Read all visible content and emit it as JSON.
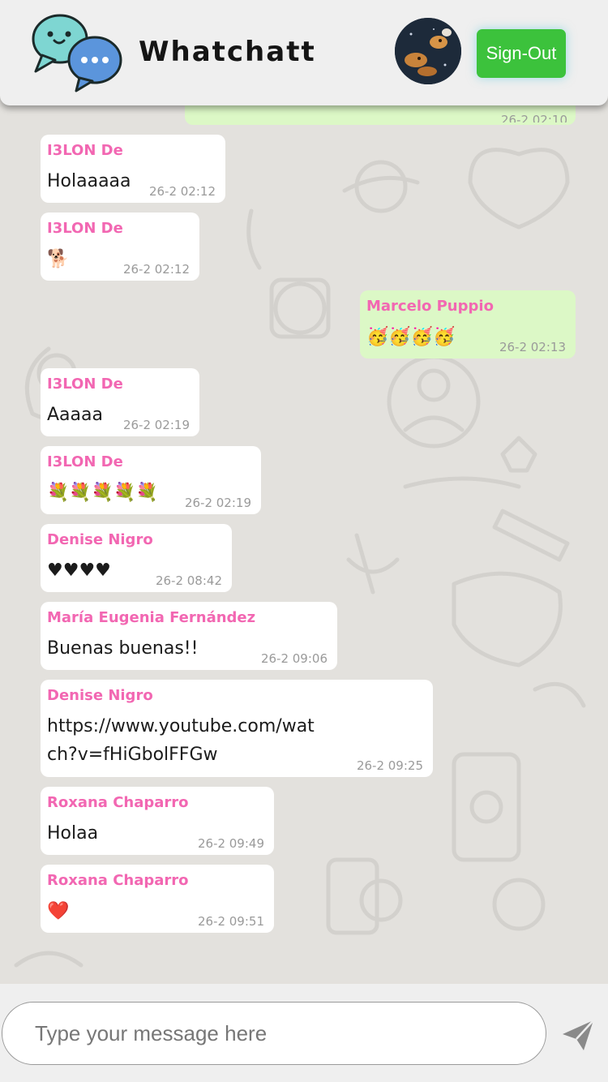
{
  "header": {
    "app_title": "Whatchatt",
    "signout_label": "Sign-Out",
    "logo_icon": "chat-bubbles-icon",
    "avatar_icon": "user-avatar"
  },
  "chat": {
    "previous_time": "26-2 02:10",
    "messages": [
      {
        "sender": "I3LON De",
        "text": "Holaaaaa",
        "time": "26-2 02:12",
        "own": false
      },
      {
        "sender": "I3LON De",
        "text": "🐕",
        "time": "26-2 02:12",
        "own": false
      },
      {
        "sender": "Marcelo Puppio",
        "text": "🥳🥳🥳🥳",
        "time": "26-2 02:13",
        "own": true
      },
      {
        "sender": "I3LON De",
        "text": "Aaaaa",
        "time": "26-2 02:19",
        "own": false
      },
      {
        "sender": "I3LON De",
        "text": "💐💐💐💐💐",
        "time": "26-2 02:19",
        "own": false
      },
      {
        "sender": "Denise Nigro",
        "text": "♥♥♥♥",
        "time": "26-2 08:42",
        "own": false
      },
      {
        "sender": "María Eugenia Fernández",
        "text": "Buenas buenas!!",
        "time": "26-2 09:06",
        "own": false
      },
      {
        "sender": "Denise Nigro",
        "text": "https://www.youtube.com/wat\nch?v=fHiGbolFFGw",
        "time": "26-2 09:25",
        "own": false
      },
      {
        "sender": "Roxana Chaparro",
        "text": "Holaa",
        "time": "26-2 09:49",
        "own": false
      },
      {
        "sender": "Roxana Chaparro",
        "text": "❤️",
        "time": "26-2 09:51",
        "own": false
      }
    ]
  },
  "composer": {
    "placeholder": "Type your message here",
    "value": "",
    "send_icon": "send-icon"
  },
  "colors": {
    "sender_name": "#f267b2",
    "own_bubble": "#dcf8c6",
    "other_bubble": "#ffffff",
    "signout_button": "#3cc23c"
  }
}
